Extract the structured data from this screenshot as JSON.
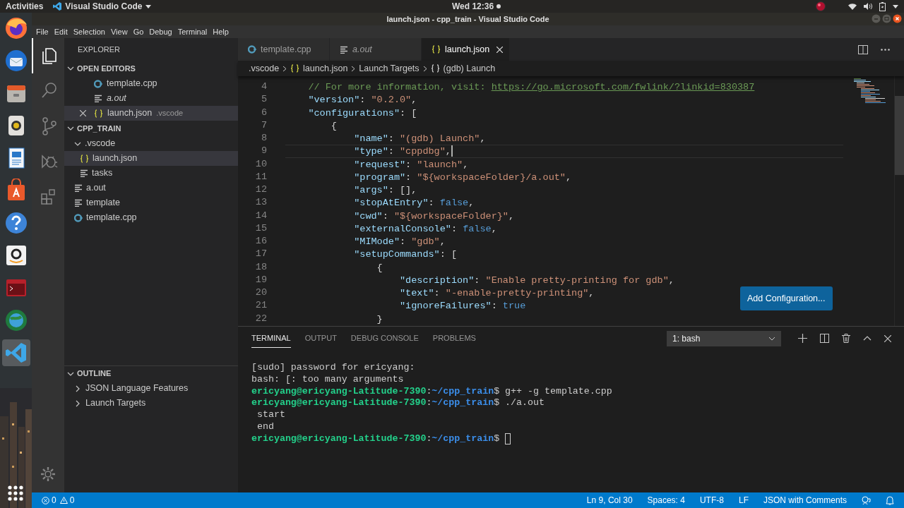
{
  "top_bar": {
    "activities": "Activities",
    "app_menu": "Visual Studio Code",
    "clock": "Wed 12:36"
  },
  "window": {
    "title": "launch.json - cpp_train - Visual Studio Code"
  },
  "menu": [
    "File",
    "Edit",
    "Selection",
    "View",
    "Go",
    "Debug",
    "Terminal",
    "Help"
  ],
  "dock": [
    {
      "selected": false
    },
    {
      "selected": false
    },
    {
      "selected": false
    },
    {
      "selected": false
    },
    {
      "selected": false
    },
    {
      "selected": false
    },
    {
      "selected": false
    },
    {
      "selected": false
    },
    {
      "selected": false
    },
    {
      "selected": false
    },
    {
      "selected": true
    }
  ],
  "activity_bar": [
    {
      "selected": true
    },
    {
      "selected": false
    },
    {
      "selected": false
    },
    {
      "selected": false
    },
    {
      "selected": false
    }
  ],
  "sidebar": {
    "title": "EXPLORER",
    "open_editors": {
      "title": "OPEN EDITORS",
      "expanded": true,
      "items": [
        {
          "name": "template.cpp",
          "kind": "cpp",
          "preview": false,
          "selected": false
        },
        {
          "name": "a.out",
          "kind": "file",
          "preview": true,
          "selected": false
        },
        {
          "name": "launch.json",
          "detail": ".vscode",
          "kind": "json",
          "preview": false,
          "selected": true
        }
      ]
    },
    "folder": {
      "title": "CPP_TRAIN",
      "expanded": true,
      "items": [
        {
          "name": ".vscode",
          "kind": "folder",
          "expanded": true,
          "selected": false,
          "children": [
            {
              "name": "launch.json",
              "kind": "json",
              "selected": true
            },
            {
              "name": "tasks",
              "kind": "file",
              "selected": false
            }
          ]
        },
        {
          "name": "a.out",
          "kind": "file",
          "selected": false
        },
        {
          "name": "template",
          "kind": "file",
          "selected": false
        },
        {
          "name": "template.cpp",
          "kind": "cpp",
          "selected": false
        }
      ]
    },
    "outline": {
      "title": "OUTLINE",
      "expanded": true,
      "items": [
        {
          "name": "JSON Language Features",
          "expanded": false
        },
        {
          "name": "Launch Targets",
          "expanded": false
        }
      ]
    }
  },
  "tabs": [
    {
      "label": "template.cpp",
      "kind": "cpp",
      "preview": false,
      "selected": false
    },
    {
      "label": "a.out",
      "kind": "file",
      "preview": true,
      "selected": false
    },
    {
      "label": "launch.json",
      "kind": "json",
      "preview": false,
      "selected": true
    }
  ],
  "breadcrumbs": [
    {
      "text": ".vscode",
      "kind": "plain"
    },
    {
      "text": "launch.json",
      "kind": "json"
    },
    {
      "text": "Launch Targets",
      "kind": "plain"
    },
    {
      "text": "(gdb) Launch",
      "kind": "object"
    }
  ],
  "editor": {
    "lines": [
      {
        "number": "4",
        "current": false,
        "tokens": [
          {
            "text": "// For more information, visit: ",
            "kind": "comment"
          },
          {
            "text": "https://go.microsoft.com/fwlink/?linkid=830387",
            "kind": "link"
          }
        ]
      },
      {
        "number": "5",
        "current": false,
        "tokens": [
          {
            "text": "\"version\"",
            "kind": "key"
          },
          {
            "text": ": ",
            "kind": "punct"
          },
          {
            "text": "\"0.2.0\"",
            "kind": "string"
          },
          {
            "text": ",",
            "kind": "punct"
          }
        ]
      },
      {
        "number": "6",
        "current": false,
        "tokens": [
          {
            "text": "\"configurations\"",
            "kind": "key"
          },
          {
            "text": ": [",
            "kind": "punct"
          }
        ]
      },
      {
        "number": "7",
        "current": false,
        "tokens": [
          {
            "text": "{",
            "kind": "punct"
          }
        ]
      },
      {
        "number": "8",
        "current": false,
        "tokens": [
          {
            "text": "\"name\"",
            "kind": "key"
          },
          {
            "text": ": ",
            "kind": "punct"
          },
          {
            "text": "\"(gdb) Launch\"",
            "kind": "string"
          },
          {
            "text": ",",
            "kind": "punct"
          }
        ]
      },
      {
        "number": "9",
        "current": true,
        "tokens": [
          {
            "text": "\"type\"",
            "kind": "key"
          },
          {
            "text": ": ",
            "kind": "punct"
          },
          {
            "text": "\"cppdbg\"",
            "kind": "string"
          },
          {
            "text": ",",
            "kind": "punct"
          }
        ]
      },
      {
        "number": "10",
        "current": false,
        "tokens": [
          {
            "text": "\"request\"",
            "kind": "key"
          },
          {
            "text": ": ",
            "kind": "punct"
          },
          {
            "text": "\"launch\"",
            "kind": "string"
          },
          {
            "text": ",",
            "kind": "punct"
          }
        ]
      },
      {
        "number": "11",
        "current": false,
        "tokens": [
          {
            "text": "\"program\"",
            "kind": "key"
          },
          {
            "text": ": ",
            "kind": "punct"
          },
          {
            "text": "\"${workspaceFolder}/a.out\"",
            "kind": "string"
          },
          {
            "text": ",",
            "kind": "punct"
          }
        ]
      },
      {
        "number": "12",
        "current": false,
        "tokens": [
          {
            "text": "\"args\"",
            "kind": "key"
          },
          {
            "text": ": [],",
            "kind": "punct"
          }
        ]
      },
      {
        "number": "13",
        "current": false,
        "tokens": [
          {
            "text": "\"stopAtEntry\"",
            "kind": "key"
          },
          {
            "text": ": ",
            "kind": "punct"
          },
          {
            "text": "false",
            "kind": "bool"
          },
          {
            "text": ",",
            "kind": "punct"
          }
        ]
      },
      {
        "number": "14",
        "current": false,
        "tokens": [
          {
            "text": "\"cwd\"",
            "kind": "key"
          },
          {
            "text": ": ",
            "kind": "punct"
          },
          {
            "text": "\"${workspaceFolder}\"",
            "kind": "string"
          },
          {
            "text": ",",
            "kind": "punct"
          }
        ]
      },
      {
        "number": "15",
        "current": false,
        "tokens": [
          {
            "text": "\"externalConsole\"",
            "kind": "key"
          },
          {
            "text": ": ",
            "kind": "punct"
          },
          {
            "text": "false",
            "kind": "bool"
          },
          {
            "text": ",",
            "kind": "punct"
          }
        ]
      },
      {
        "number": "16",
        "current": false,
        "tokens": [
          {
            "text": "\"MIMode\"",
            "kind": "key"
          },
          {
            "text": ": ",
            "kind": "punct"
          },
          {
            "text": "\"gdb\"",
            "kind": "string"
          },
          {
            "text": ",",
            "kind": "punct"
          }
        ]
      },
      {
        "number": "17",
        "current": false,
        "tokens": [
          {
            "text": "\"setupCommands\"",
            "kind": "key"
          },
          {
            "text": ": [",
            "kind": "punct"
          }
        ]
      },
      {
        "number": "18",
        "current": false,
        "tokens": [
          {
            "text": "{",
            "kind": "punct"
          }
        ]
      },
      {
        "number": "19",
        "current": false,
        "tokens": [
          {
            "text": "\"description\"",
            "kind": "key"
          },
          {
            "text": ": ",
            "kind": "punct"
          },
          {
            "text": "\"Enable pretty-printing for gdb\"",
            "kind": "string"
          },
          {
            "text": ",",
            "kind": "punct"
          }
        ]
      },
      {
        "number": "20",
        "current": false,
        "tokens": [
          {
            "text": "\"text\"",
            "kind": "key"
          },
          {
            "text": ": ",
            "kind": "punct"
          },
          {
            "text": "\"-enable-pretty-printing\"",
            "kind": "string"
          },
          {
            "text": ",",
            "kind": "punct"
          }
        ]
      },
      {
        "number": "21",
        "current": false,
        "tokens": [
          {
            "text": "\"ignoreFailures\"",
            "kind": "key"
          },
          {
            "text": ": ",
            "kind": "punct"
          },
          {
            "text": "true",
            "kind": "bool"
          }
        ]
      },
      {
        "number": "22",
        "current": false,
        "tokens": [
          {
            "text": "}",
            "kind": "punct"
          }
        ]
      }
    ],
    "add_button": "Add Configuration..."
  },
  "panel": {
    "tabs": [
      {
        "label": "TERMINAL",
        "selected": true
      },
      {
        "label": "OUTPUT",
        "selected": false
      },
      {
        "label": "DEBUG CONSOLE",
        "selected": false
      },
      {
        "label": "PROBLEMS",
        "selected": false
      }
    ],
    "terminal_select": "1: bash",
    "lines": [
      {
        "cursor": false,
        "segments": [
          {
            "text": "[sudo] password for ericyang:",
            "kind": "plain"
          }
        ]
      },
      {
        "cursor": false,
        "segments": [
          {
            "text": "bash: [: too many arguments",
            "kind": "plain"
          }
        ]
      },
      {
        "cursor": false,
        "segments": [
          {
            "text": "ericyang@ericyang-Latitude-7390",
            "kind": "user"
          },
          {
            "text": ":",
            "kind": "plain"
          },
          {
            "text": "~/cpp_train",
            "kind": "path"
          },
          {
            "text": "$ g++ -g template.cpp",
            "kind": "plain"
          }
        ]
      },
      {
        "cursor": false,
        "segments": [
          {
            "text": "ericyang@ericyang-Latitude-7390",
            "kind": "user"
          },
          {
            "text": ":",
            "kind": "plain"
          },
          {
            "text": "~/cpp_train",
            "kind": "path"
          },
          {
            "text": "$ ./a.out",
            "kind": "plain"
          }
        ]
      },
      {
        "cursor": false,
        "segments": [
          {
            "text": " start",
            "kind": "plain"
          }
        ]
      },
      {
        "cursor": false,
        "segments": [
          {
            "text": " end",
            "kind": "plain"
          }
        ]
      },
      {
        "cursor": true,
        "segments": [
          {
            "text": "ericyang@ericyang-Latitude-7390",
            "kind": "user"
          },
          {
            "text": ":",
            "kind": "plain"
          },
          {
            "text": "~/cpp_train",
            "kind": "path"
          },
          {
            "text": "$",
            "kind": "plain"
          }
        ]
      }
    ]
  },
  "status_bar": {
    "errors": "0",
    "warnings": "0",
    "items": [
      "Ln 9, Col 30",
      "Spaces: 4",
      "UTF-8",
      "LF",
      "JSON with Comments"
    ]
  }
}
